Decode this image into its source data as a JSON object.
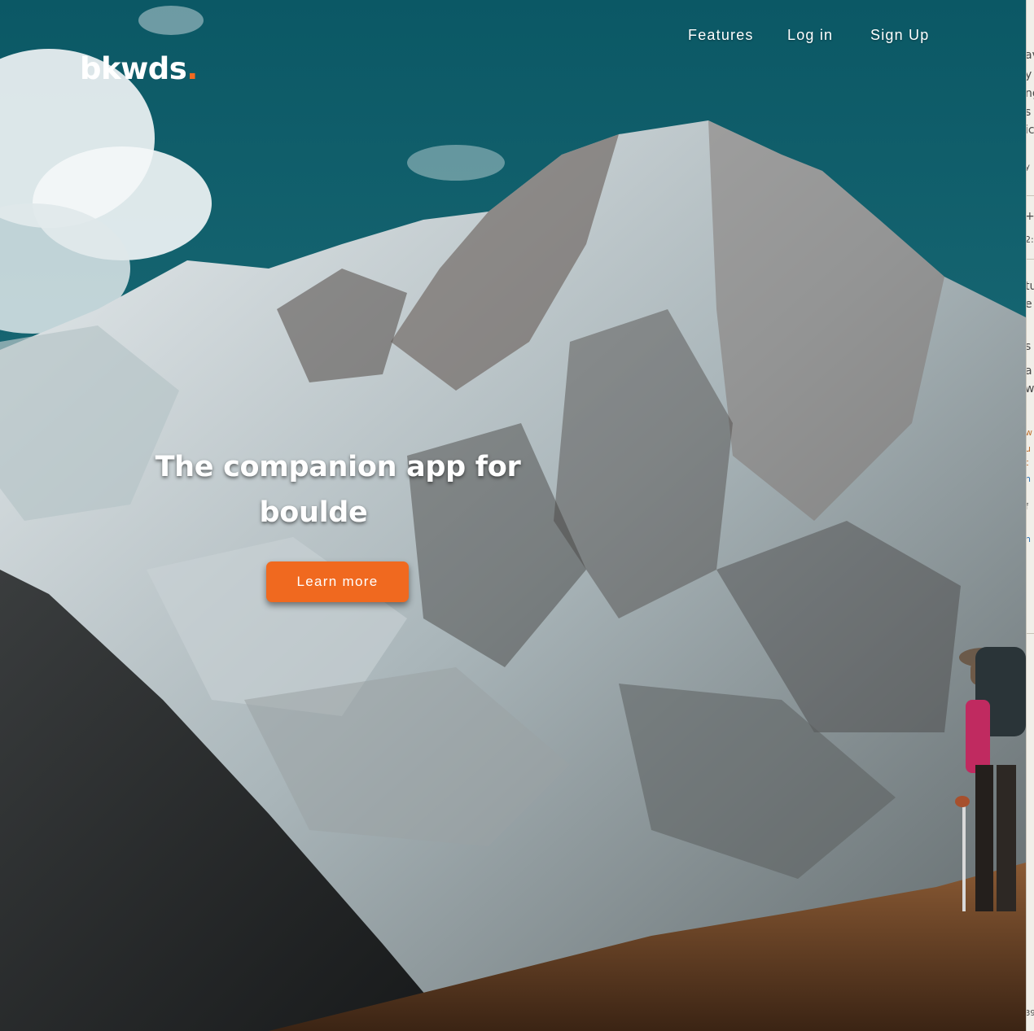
{
  "brand": {
    "name": "bkwds",
    "dot": ".",
    "accent_color": "#f26a21"
  },
  "nav": {
    "items": [
      {
        "label": "Features"
      },
      {
        "label": "Log in"
      },
      {
        "label": "Sign Up"
      }
    ]
  },
  "hero": {
    "headline_line1": "The companion app for",
    "headline_line2": "boulde",
    "cta_label": "Learn more",
    "cta_color": "#f0691f",
    "background": "mountain-landscape-photo"
  },
  "side_panel": {
    "fragments": [
      "av",
      "y l",
      "ng",
      "s",
      "ic",
      "y",
      "+",
      "2:",
      "tu",
      "e",
      "s",
      "a",
      "w",
      "w",
      "u",
      "t",
      "n",
      "f",
      "n",
      "39"
    ]
  }
}
